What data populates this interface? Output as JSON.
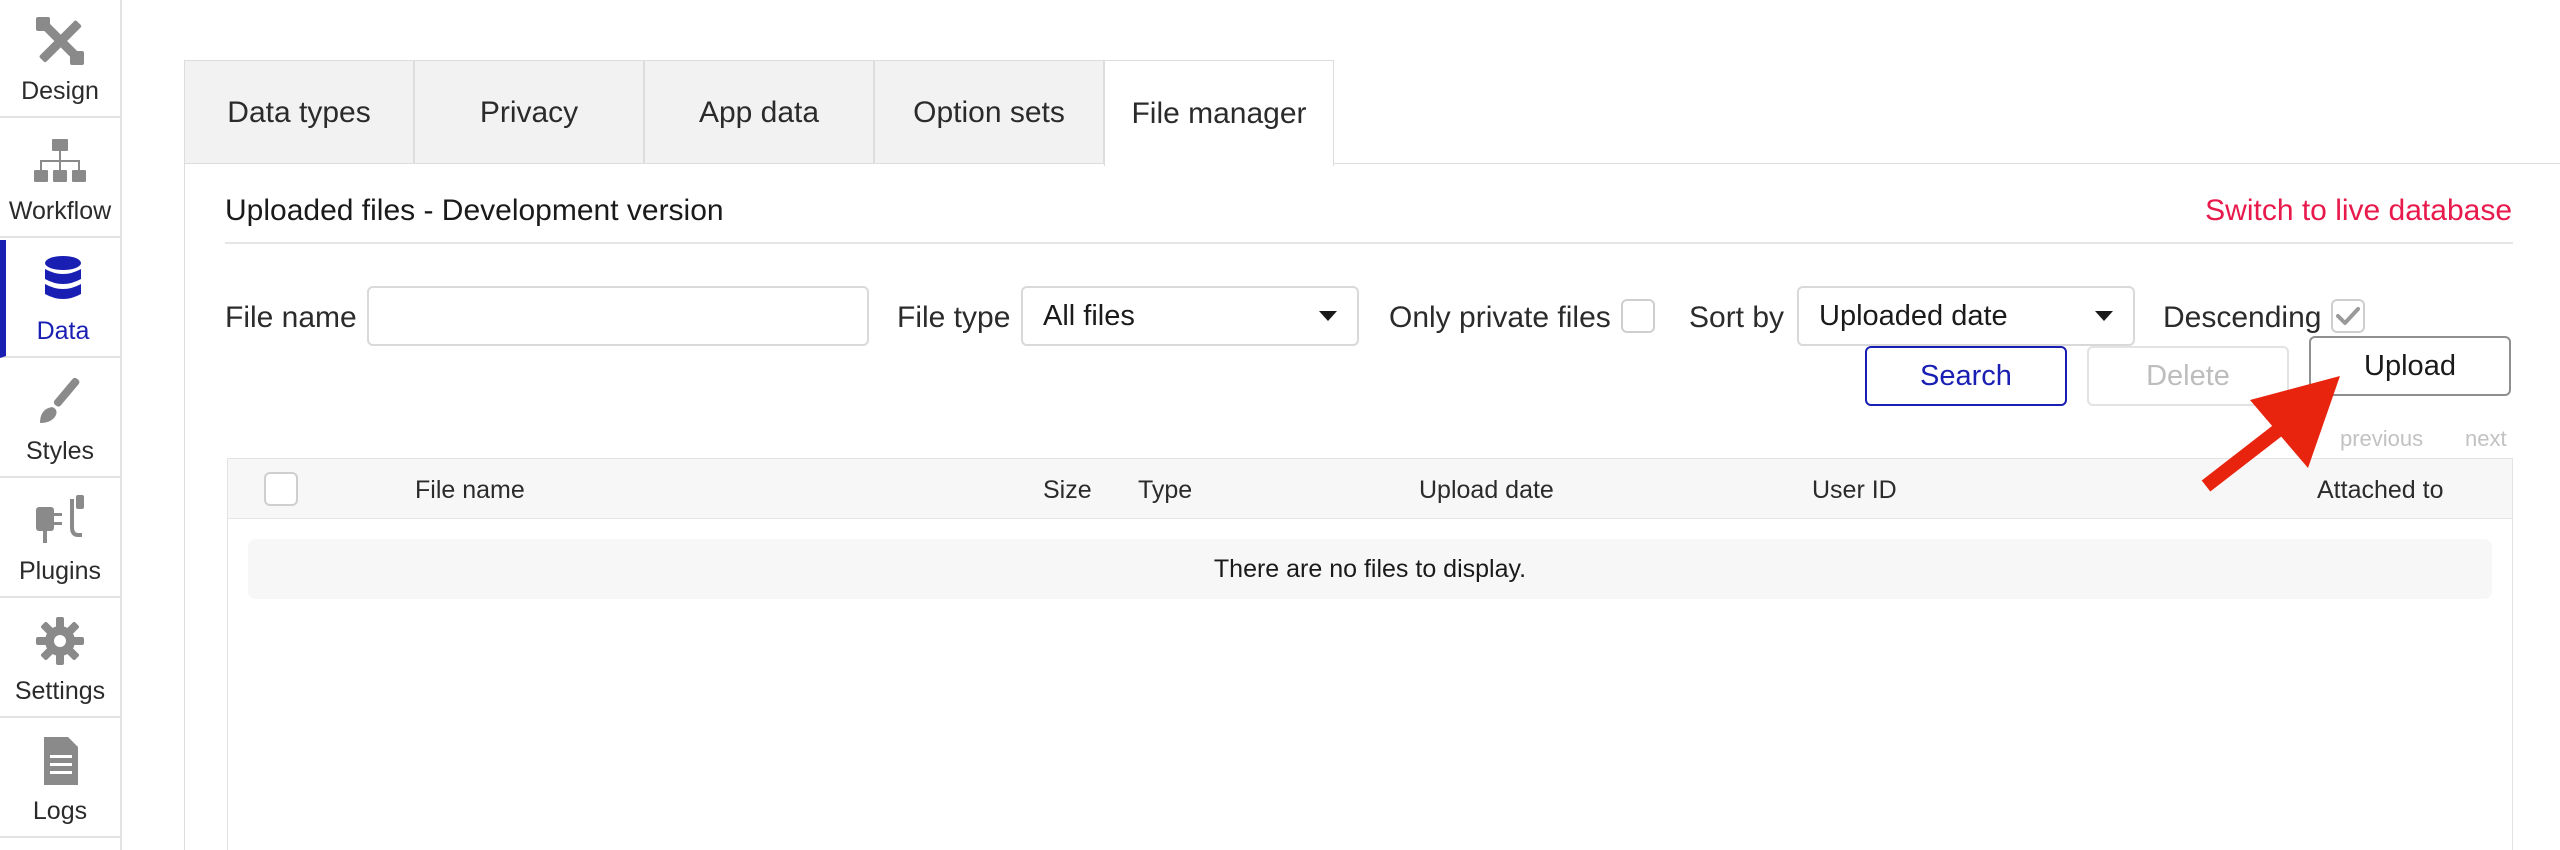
{
  "sidebar": {
    "items": [
      {
        "label": "Design",
        "icon": "design-tools-icon",
        "active": false
      },
      {
        "label": "Workflow",
        "icon": "workflow-icon",
        "active": false
      },
      {
        "label": "Data",
        "icon": "database-icon",
        "active": true
      },
      {
        "label": "Styles",
        "icon": "brush-icon",
        "active": false
      },
      {
        "label": "Plugins",
        "icon": "plug-icon",
        "active": false
      },
      {
        "label": "Settings",
        "icon": "gear-icon",
        "active": false
      },
      {
        "label": "Logs",
        "icon": "document-icon",
        "active": false
      }
    ]
  },
  "tabs": [
    {
      "label": "Data types",
      "active": false
    },
    {
      "label": "Privacy",
      "active": false
    },
    {
      "label": "App data",
      "active": false
    },
    {
      "label": "Option sets",
      "active": false
    },
    {
      "label": "File manager",
      "active": true
    }
  ],
  "panel": {
    "title": "Uploaded files - Development version",
    "switch_link": "Switch to live database"
  },
  "filters": {
    "file_name_label": "File name",
    "file_name_value": "",
    "file_type_label": "File type",
    "file_type_value": "All files",
    "private_label": "Only private files",
    "private_checked": false,
    "sort_by_label": "Sort by",
    "sort_by_value": "Uploaded date",
    "descending_label": "Descending",
    "descending_checked": true
  },
  "buttons": {
    "search": "Search",
    "delete": "Delete",
    "upload": "Upload"
  },
  "pager": {
    "previous": "previous",
    "next": "next"
  },
  "table": {
    "columns": [
      "File name",
      "Size",
      "Type",
      "Upload date",
      "User ID",
      "Attached to"
    ],
    "empty_message": "There are no files to display."
  },
  "colors": {
    "accent": "#1a1fb3",
    "link": "#e8194b",
    "annotation_arrow": "#e8240f"
  }
}
